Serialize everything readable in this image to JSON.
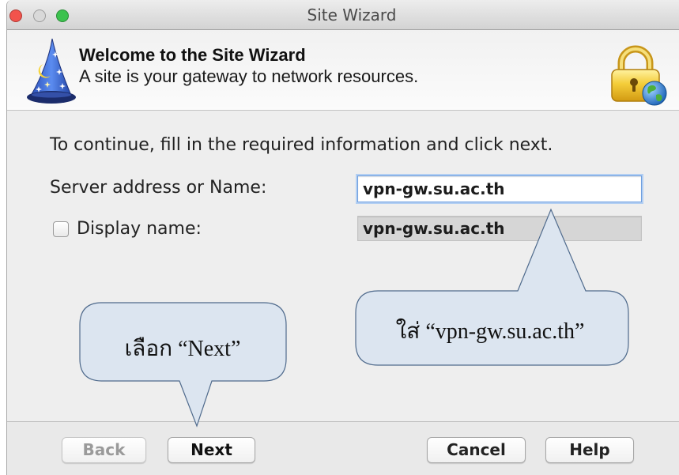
{
  "window": {
    "title": "Site Wizard",
    "controls": {
      "close_color": "#f2534c",
      "minimize_color": "#d9d9d9",
      "zoom_color": "#3cc24e"
    }
  },
  "header": {
    "title": "Welcome to the Site Wizard",
    "subtitle": "A site is your gateway to network resources.",
    "left_icon": "wizard-hat-icon",
    "right_icon": "lock-globe-icon"
  },
  "form": {
    "instructions": "To continue, fill in the required information and click next.",
    "server_address": {
      "label": "Server address or Name:",
      "value": "vpn-gw.su.ac.th"
    },
    "display_name": {
      "label": "Display name:",
      "checked": false,
      "value": "vpn-gw.su.ac.th"
    }
  },
  "buttons": {
    "back": {
      "label": "Back",
      "enabled": false
    },
    "next": {
      "label": "Next",
      "enabled": true
    },
    "cancel": {
      "label": "Cancel",
      "enabled": true
    },
    "help": {
      "label": "Help",
      "enabled": true
    }
  },
  "annotations": [
    {
      "text": "เลือก “Next”"
    },
    {
      "text": "ใส่ “vpn-gw.su.ac.th”"
    }
  ],
  "colors": {
    "callout_fill": "#dce5f0",
    "callout_stroke": "#4f6a8c",
    "focus_ring": "#6f9fdf",
    "disabled_field": "#d6d6d6"
  }
}
